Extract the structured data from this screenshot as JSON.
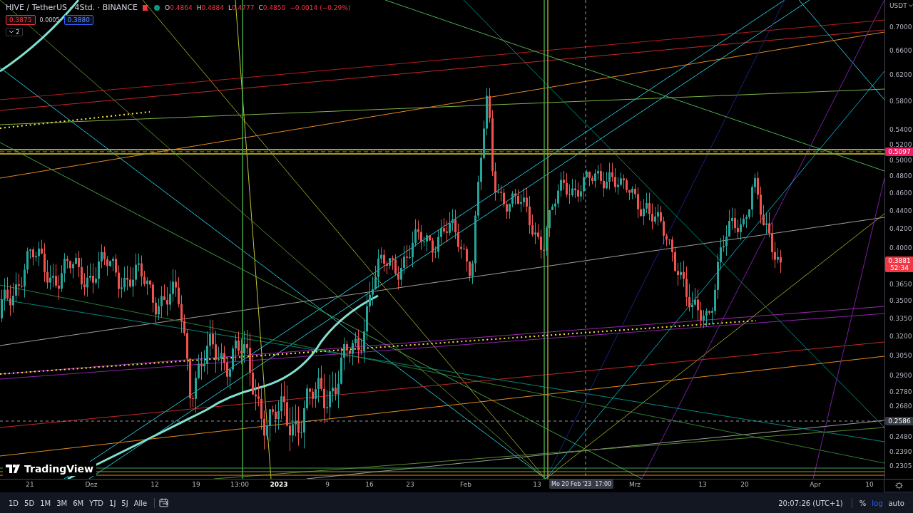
{
  "header": {
    "symbol": "HIVE / TetherUS · 4Std. · BINANCE",
    "ohlc": [
      {
        "label": "O",
        "value": "0.4864"
      },
      {
        "label": "H",
        "value": "0.4884"
      },
      {
        "label": "L",
        "value": "0.4777"
      },
      {
        "label": "C",
        "value": "0.4850"
      }
    ],
    "change": "−0.0014 (−0.29%)",
    "bid": "0.3875",
    "spread": "0.0005",
    "ask": "0.3880",
    "indicators_count": "2"
  },
  "logo": "TradingView",
  "price_axis": {
    "currency": "USDT",
    "ticks": [
      "0.7000",
      "0.6600",
      "0.6200",
      "0.5800",
      "0.5400",
      "0.5200",
      "0.5000",
      "0.4800",
      "0.4600",
      "0.4400",
      "0.4200",
      "0.4000",
      "0.3650",
      "0.3500",
      "0.3350",
      "0.3200",
      "0.3050",
      "0.2900",
      "0.2780",
      "0.2680",
      "0.2480",
      "0.2390",
      "0.2305"
    ],
    "line_price": "0.5097",
    "last_price": "0.3881",
    "countdown": "52:34",
    "crosshair_price": "0.2586"
  },
  "time_axis": {
    "labels": [
      {
        "text": "21",
        "emphasized": false
      },
      {
        "text": "Dez",
        "emphasized": false
      },
      {
        "text": "12",
        "emphasized": false
      },
      {
        "text": "19",
        "emphasized": false
      },
      {
        "text": "13:00",
        "emphasized": false
      },
      {
        "text": "2023",
        "emphasized": true
      },
      {
        "text": "9",
        "emphasized": false
      },
      {
        "text": "16",
        "emphasized": false
      },
      {
        "text": "23",
        "emphasized": false
      },
      {
        "text": "Feb",
        "emphasized": false
      },
      {
        "text": "13",
        "emphasized": false
      },
      {
        "text": "Mrz",
        "emphasized": false
      },
      {
        "text": "13",
        "emphasized": false
      },
      {
        "text": "20",
        "emphasized": false
      },
      {
        "text": "Apr",
        "emphasized": false
      },
      {
        "text": "10",
        "emphasized": false
      }
    ],
    "crosshair_date": "Mo 20 Feb '23",
    "crosshair_time": "17:00"
  },
  "toolbar": {
    "ranges": [
      "1D",
      "5D",
      "1M",
      "3M",
      "6M",
      "YTD",
      "1J",
      "5J",
      "Alle"
    ],
    "clock": "20:07:26 (UTC+1)",
    "options": [
      {
        "label": "%",
        "selected": false
      },
      {
        "label": "log",
        "selected": true
      },
      {
        "label": "auto",
        "selected": false
      }
    ]
  }
}
